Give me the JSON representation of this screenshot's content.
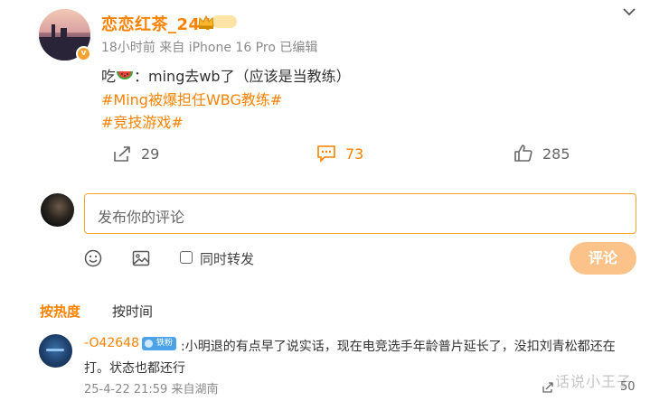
{
  "post": {
    "username": "恋恋红茶_244",
    "meta": "18小时前 来自 iPhone 16 Pro 已编辑",
    "text_prefix": "吃",
    "text_body": "：ming去wb了（应该是当教练）",
    "topics": [
      "#Ming被爆担任WBG教练#",
      "#竞技游戏#"
    ],
    "actions": {
      "share_count": "29",
      "comment_count": "73",
      "like_count": "285"
    }
  },
  "comment_box": {
    "placeholder": "发布你的评论",
    "repost_label": "同时转发",
    "submit_label": "评论"
  },
  "sort": {
    "hot_label": "按热度",
    "time_label": "按时间"
  },
  "comments": [
    {
      "user": "-O42648",
      "badge": "铁粉",
      "text": ":小明退的有点早了说实话，现在电竞选手年龄普片延长了，没扣刘青松都还在打。状态也都还行",
      "meta": "25-4-22 21:59 来自湖南",
      "likes": "50"
    }
  ],
  "watermark": "话说小王子",
  "colors": {
    "accent": "#ff8200",
    "submit_disabled": "#fbc38a",
    "input_border": "#f7a12f"
  },
  "icons": [
    "chevron-down-icon",
    "watermelon-icon",
    "share-icon",
    "comment-icon",
    "like-icon",
    "emoji-icon",
    "image-icon"
  ]
}
